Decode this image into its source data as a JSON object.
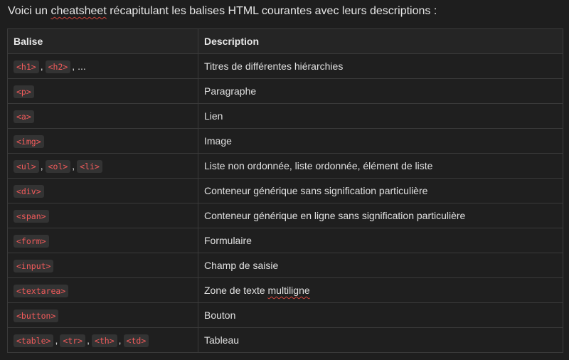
{
  "intro": {
    "before": "Voici un ",
    "misspelled": "cheatsheet",
    "after": " récapitulant les balises HTML courantes avec leurs descriptions :"
  },
  "table": {
    "headers": [
      "Balise",
      "Description"
    ],
    "rows": [
      {
        "tags": [
          "<h1>",
          "<h2>"
        ],
        "suffix": ", ...",
        "desc": "Titres de différentes hiérarchies"
      },
      {
        "tags": [
          "<p>"
        ],
        "suffix": "",
        "desc": "Paragraphe"
      },
      {
        "tags": [
          "<a>"
        ],
        "suffix": "",
        "desc": "Lien"
      },
      {
        "tags": [
          "<img>"
        ],
        "suffix": "",
        "desc": "Image"
      },
      {
        "tags": [
          "<ul>",
          "<ol>",
          "<li>"
        ],
        "suffix": "",
        "desc": "Liste non ordonnée, liste ordonnée, élément de liste"
      },
      {
        "tags": [
          "<div>"
        ],
        "suffix": "",
        "desc": "Conteneur générique sans signification particulière"
      },
      {
        "tags": [
          "<span>"
        ],
        "suffix": "",
        "desc": "Conteneur générique en ligne sans signification particulière"
      },
      {
        "tags": [
          "<form>"
        ],
        "suffix": "",
        "desc": "Formulaire"
      },
      {
        "tags": [
          "<input>"
        ],
        "suffix": "",
        "desc": "Champ de saisie"
      },
      {
        "tags": [
          "<textarea>"
        ],
        "suffix": "",
        "desc": "Zone de texte multiligne",
        "desc_misspelled": "multiligne"
      },
      {
        "tags": [
          "<button>"
        ],
        "suffix": "",
        "desc": "Bouton"
      },
      {
        "tags": [
          "<table>",
          "<tr>",
          "<th>",
          "<td>"
        ],
        "suffix": "",
        "desc": "Tableau"
      }
    ]
  },
  "colors": {
    "background": "#1e1e1e",
    "code_text": "#f25b5b",
    "code_bg": "#333333",
    "border": "#3a3a3a"
  }
}
